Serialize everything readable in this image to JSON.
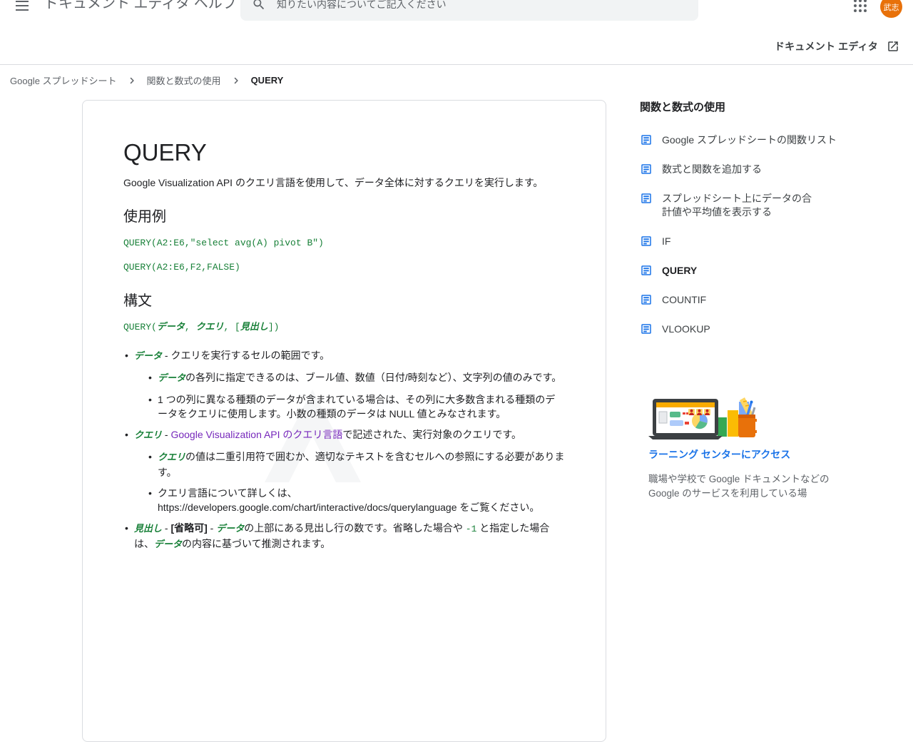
{
  "colors": {
    "accent_blue": "#1a73e8",
    "code_green": "#188038",
    "visited_purple": "#7627bb",
    "avatar_orange": "#e8710a",
    "search_bg": "#f1f3f4"
  },
  "header": {
    "app_title": "ドキュメント エディタ ヘルプ",
    "search_placeholder": "知りたい内容についてご記入ください",
    "avatar_initials": "武志",
    "product_link_label": "ドキュメント エディタ"
  },
  "breadcrumb": {
    "items": [
      "Google スプレッドシート",
      "関数と数式の使用",
      "QUERY"
    ]
  },
  "article": {
    "title": "QUERY",
    "description": "Google Visualization API のクエリ言語を使用して、データ全体に対するクエリを実行します。",
    "usage_heading": "使用例",
    "examples": [
      "QUERY(A2:E6,\"select avg(A) pivot B\")",
      "QUERY(A2:E6,F2,FALSE)"
    ],
    "syntax_heading": "構文",
    "syntax": {
      "prefix": "QUERY(",
      "p1": "データ",
      "sep1": ", ",
      "p2": "クエリ",
      "sep2": ", [",
      "p3": "見出し",
      "suffix": "])"
    },
    "b1": {
      "param": "データ",
      "dash": " - ",
      "text": "クエリを実行するセルの範囲です。"
    },
    "b1a": {
      "param": "データ",
      "text": "の各列に指定できるのは、ブール値、数値（日付/時刻など）、文字列の値のみです。"
    },
    "b1b": {
      "text": "1 つの列に異なる種類のデータが含まれている場合は、その列に大多数含まれる種類のデータをクエリに使用します。小数の種類のデータは NULL 値とみなされます。"
    },
    "b2": {
      "param": "クエリ",
      "dash": " - ",
      "link": "Google Visualization API のクエリ言語",
      "text": "で記述された、実行対象のクエリです。"
    },
    "b2a": {
      "param": "クエリ",
      "text": "の値は二重引用符で囲むか、適切なテキストを含むセルへの参照にする必要があります。"
    },
    "b2b": {
      "text": "クエリ言語について詳しくは、https://developers.google.com/chart/interactive/docs/querylanguage をご覧ください。"
    },
    "b3": {
      "param": "見出し",
      "dash1": " - ",
      "optional": "[省略可]",
      "dash2": " - ",
      "param2": "データ",
      "text1": "の上部にある見出し行の数です。省略した場合や ",
      "code": "-1",
      "text2": " と指定した場合は、",
      "param3": "データ",
      "text3": "の内容に基づいて推測されます。"
    }
  },
  "sidebar": {
    "heading": "関数と数式の使用",
    "items": [
      {
        "label": "Google スプレッドシートの関数リスト"
      },
      {
        "label": "数式と関数を追加する"
      },
      {
        "label": "スプレッドシート上にデータの合計値や平均値を表示する"
      },
      {
        "label": "IF"
      },
      {
        "label": "QUERY"
      },
      {
        "label": "COUNTIF"
      },
      {
        "label": "VLOOKUP"
      }
    ]
  },
  "learning": {
    "link_label": "ラーニング センターにアクセス",
    "blurb": "職場や学校で Google ドキュメントなどの Google のサービスを利用している場"
  }
}
